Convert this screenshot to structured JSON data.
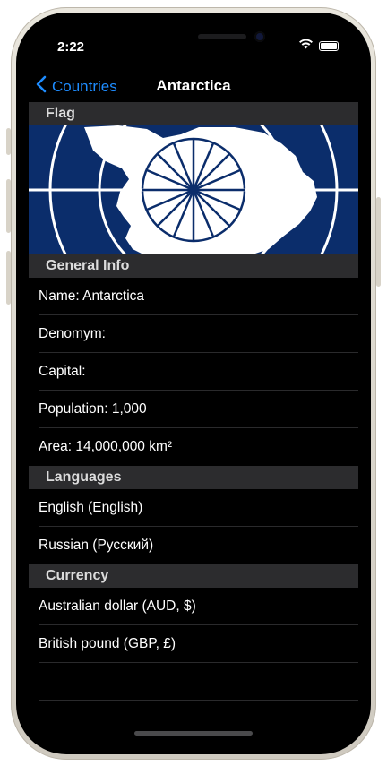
{
  "status_bar": {
    "time": "2:22"
  },
  "nav": {
    "back_label": "Countries",
    "title": "Antarctica"
  },
  "sections": {
    "flag_header": "Flag",
    "general_header": "General Info",
    "languages_header": "Languages",
    "currency_header": "Currency"
  },
  "general_info": {
    "name": "Name: Antarctica",
    "denonym": "Denomym:",
    "capital": "Capital:",
    "population": "Population: 1,000",
    "area": "Area: 14,000,000 km²"
  },
  "languages": [
    "English (English)",
    "Russian (Русский)"
  ],
  "currencies": [
    "Australian dollar (AUD, $)",
    "British pound (GBP, £)"
  ],
  "colors": {
    "accent": "#1e8cff",
    "flag_blue": "#0b2d6b",
    "header_bg": "#2c2c2e"
  },
  "icons": {
    "back": "chevron-left-icon",
    "wifi": "wifi-icon",
    "battery": "battery-icon"
  }
}
